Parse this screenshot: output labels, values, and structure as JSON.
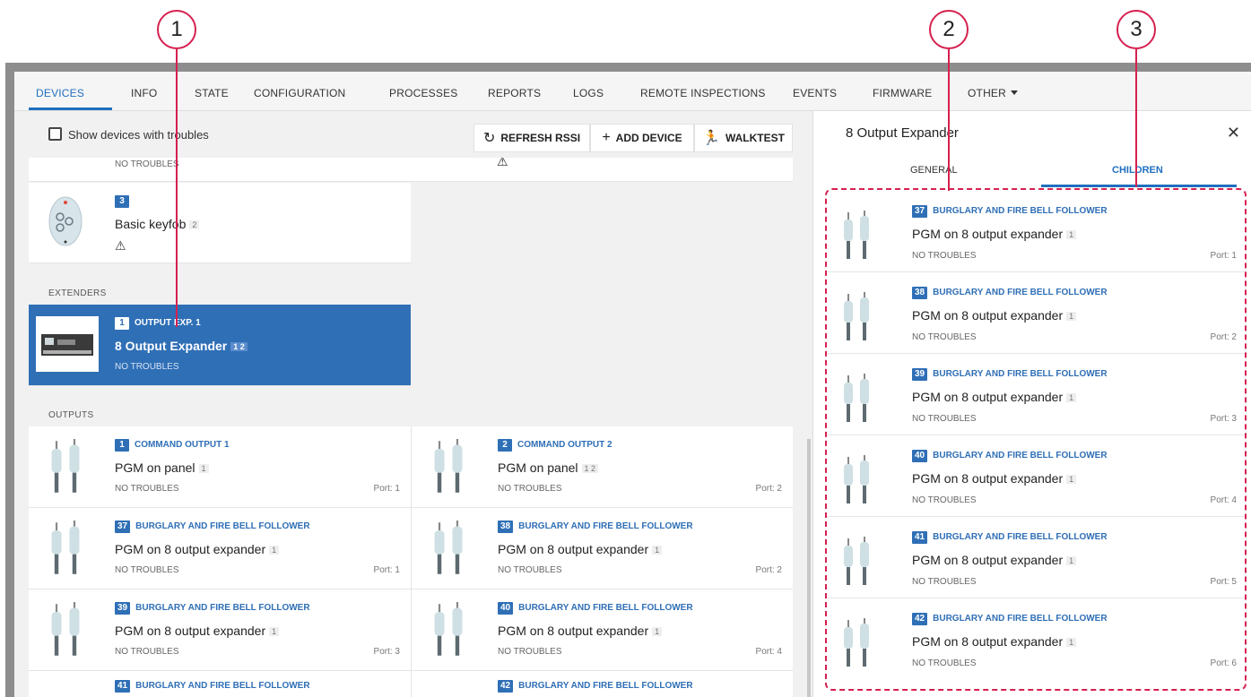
{
  "callouts": [
    "1",
    "2",
    "3"
  ],
  "nav": {
    "tabs": [
      "DEVICES",
      "INFO",
      "STATE",
      "CONFIGURATION",
      "PROCESSES",
      "REPORTS",
      "LOGS",
      "REMOTE INSPECTIONS",
      "EVENTS",
      "FIRMWARE",
      "OTHER"
    ],
    "active": "DEVICES"
  },
  "toolbar": {
    "checkbox_label": "Show devices with troubles",
    "refresh_label": "REFRESH RSSI",
    "add_label": "ADD DEVICE",
    "walktest_label": "WALKTEST"
  },
  "list": {
    "partial_top_left_status": "NO TROUBLES",
    "keyfob": {
      "id": "3",
      "name": "Basic keyfob",
      "partition": "2"
    },
    "extenders_label": "EXTENDERS",
    "extender": {
      "id": "1",
      "type": "OUTPUT EXP. 1",
      "name": "8 Output Expander",
      "partitions": "1 2",
      "status": "NO TROUBLES"
    },
    "outputs_label": "OUTPUTS",
    "outputs": [
      {
        "id": "1",
        "type": "COMMAND OUTPUT 1",
        "name": "PGM on panel",
        "partitions": "1",
        "status": "NO TROUBLES",
        "port": "Port: 1"
      },
      {
        "id": "2",
        "type": "COMMAND OUTPUT 2",
        "name": "PGM on panel",
        "partitions": "1 2",
        "status": "NO TROUBLES",
        "port": "Port: 2"
      },
      {
        "id": "37",
        "type": "BURGLARY AND FIRE BELL FOLLOWER",
        "name": "PGM on 8 output expander",
        "partitions": "1",
        "status": "NO TROUBLES",
        "port": "Port: 1"
      },
      {
        "id": "38",
        "type": "BURGLARY AND FIRE BELL FOLLOWER",
        "name": "PGM on 8 output expander",
        "partitions": "1",
        "status": "NO TROUBLES",
        "port": "Port: 2"
      },
      {
        "id": "39",
        "type": "BURGLARY AND FIRE BELL FOLLOWER",
        "name": "PGM on 8 output expander",
        "partitions": "1",
        "status": "NO TROUBLES",
        "port": "Port: 3"
      },
      {
        "id": "40",
        "type": "BURGLARY AND FIRE BELL FOLLOWER",
        "name": "PGM on 8 output expander",
        "partitions": "1",
        "status": "NO TROUBLES",
        "port": "Port: 4"
      },
      {
        "id": "41",
        "type": "BURGLARY AND FIRE BELL FOLLOWER"
      },
      {
        "id": "42",
        "type": "BURGLARY AND FIRE BELL FOLLOWER"
      }
    ]
  },
  "panel": {
    "title": "8 Output Expander",
    "tabs": [
      "GENERAL",
      "CHILDREN"
    ],
    "active_tab": "CHILDREN",
    "children": [
      {
        "id": "37",
        "type": "BURGLARY AND FIRE BELL FOLLOWER",
        "name": "PGM on 8 output expander",
        "partitions": "1",
        "status": "NO TROUBLES",
        "port": "Port: 1"
      },
      {
        "id": "38",
        "type": "BURGLARY AND FIRE BELL FOLLOWER",
        "name": "PGM on 8 output expander",
        "partitions": "1",
        "status": "NO TROUBLES",
        "port": "Port: 2"
      },
      {
        "id": "39",
        "type": "BURGLARY AND FIRE BELL FOLLOWER",
        "name": "PGM on 8 output expander",
        "partitions": "1",
        "status": "NO TROUBLES",
        "port": "Port: 3"
      },
      {
        "id": "40",
        "type": "BURGLARY AND FIRE BELL FOLLOWER",
        "name": "PGM on 8 output expander",
        "partitions": "1",
        "status": "NO TROUBLES",
        "port": "Port: 4"
      },
      {
        "id": "41",
        "type": "BURGLARY AND FIRE BELL FOLLOWER",
        "name": "PGM on 8 output expander",
        "partitions": "1",
        "status": "NO TROUBLES",
        "port": "Port: 5"
      },
      {
        "id": "42",
        "type": "BURGLARY AND FIRE BELL FOLLOWER",
        "name": "PGM on 8 output expander",
        "partitions": "1",
        "status": "NO TROUBLES",
        "port": "Port: 6"
      }
    ]
  },
  "icons": {
    "refresh": "refresh-icon",
    "add": "plus-icon",
    "walktest": "walk-icon",
    "close": "close-icon",
    "warning": "warning-icon"
  },
  "colors": {
    "accent": "#1f6fbf",
    "selected": "#2f6fb6",
    "callout": "#d6204f"
  }
}
